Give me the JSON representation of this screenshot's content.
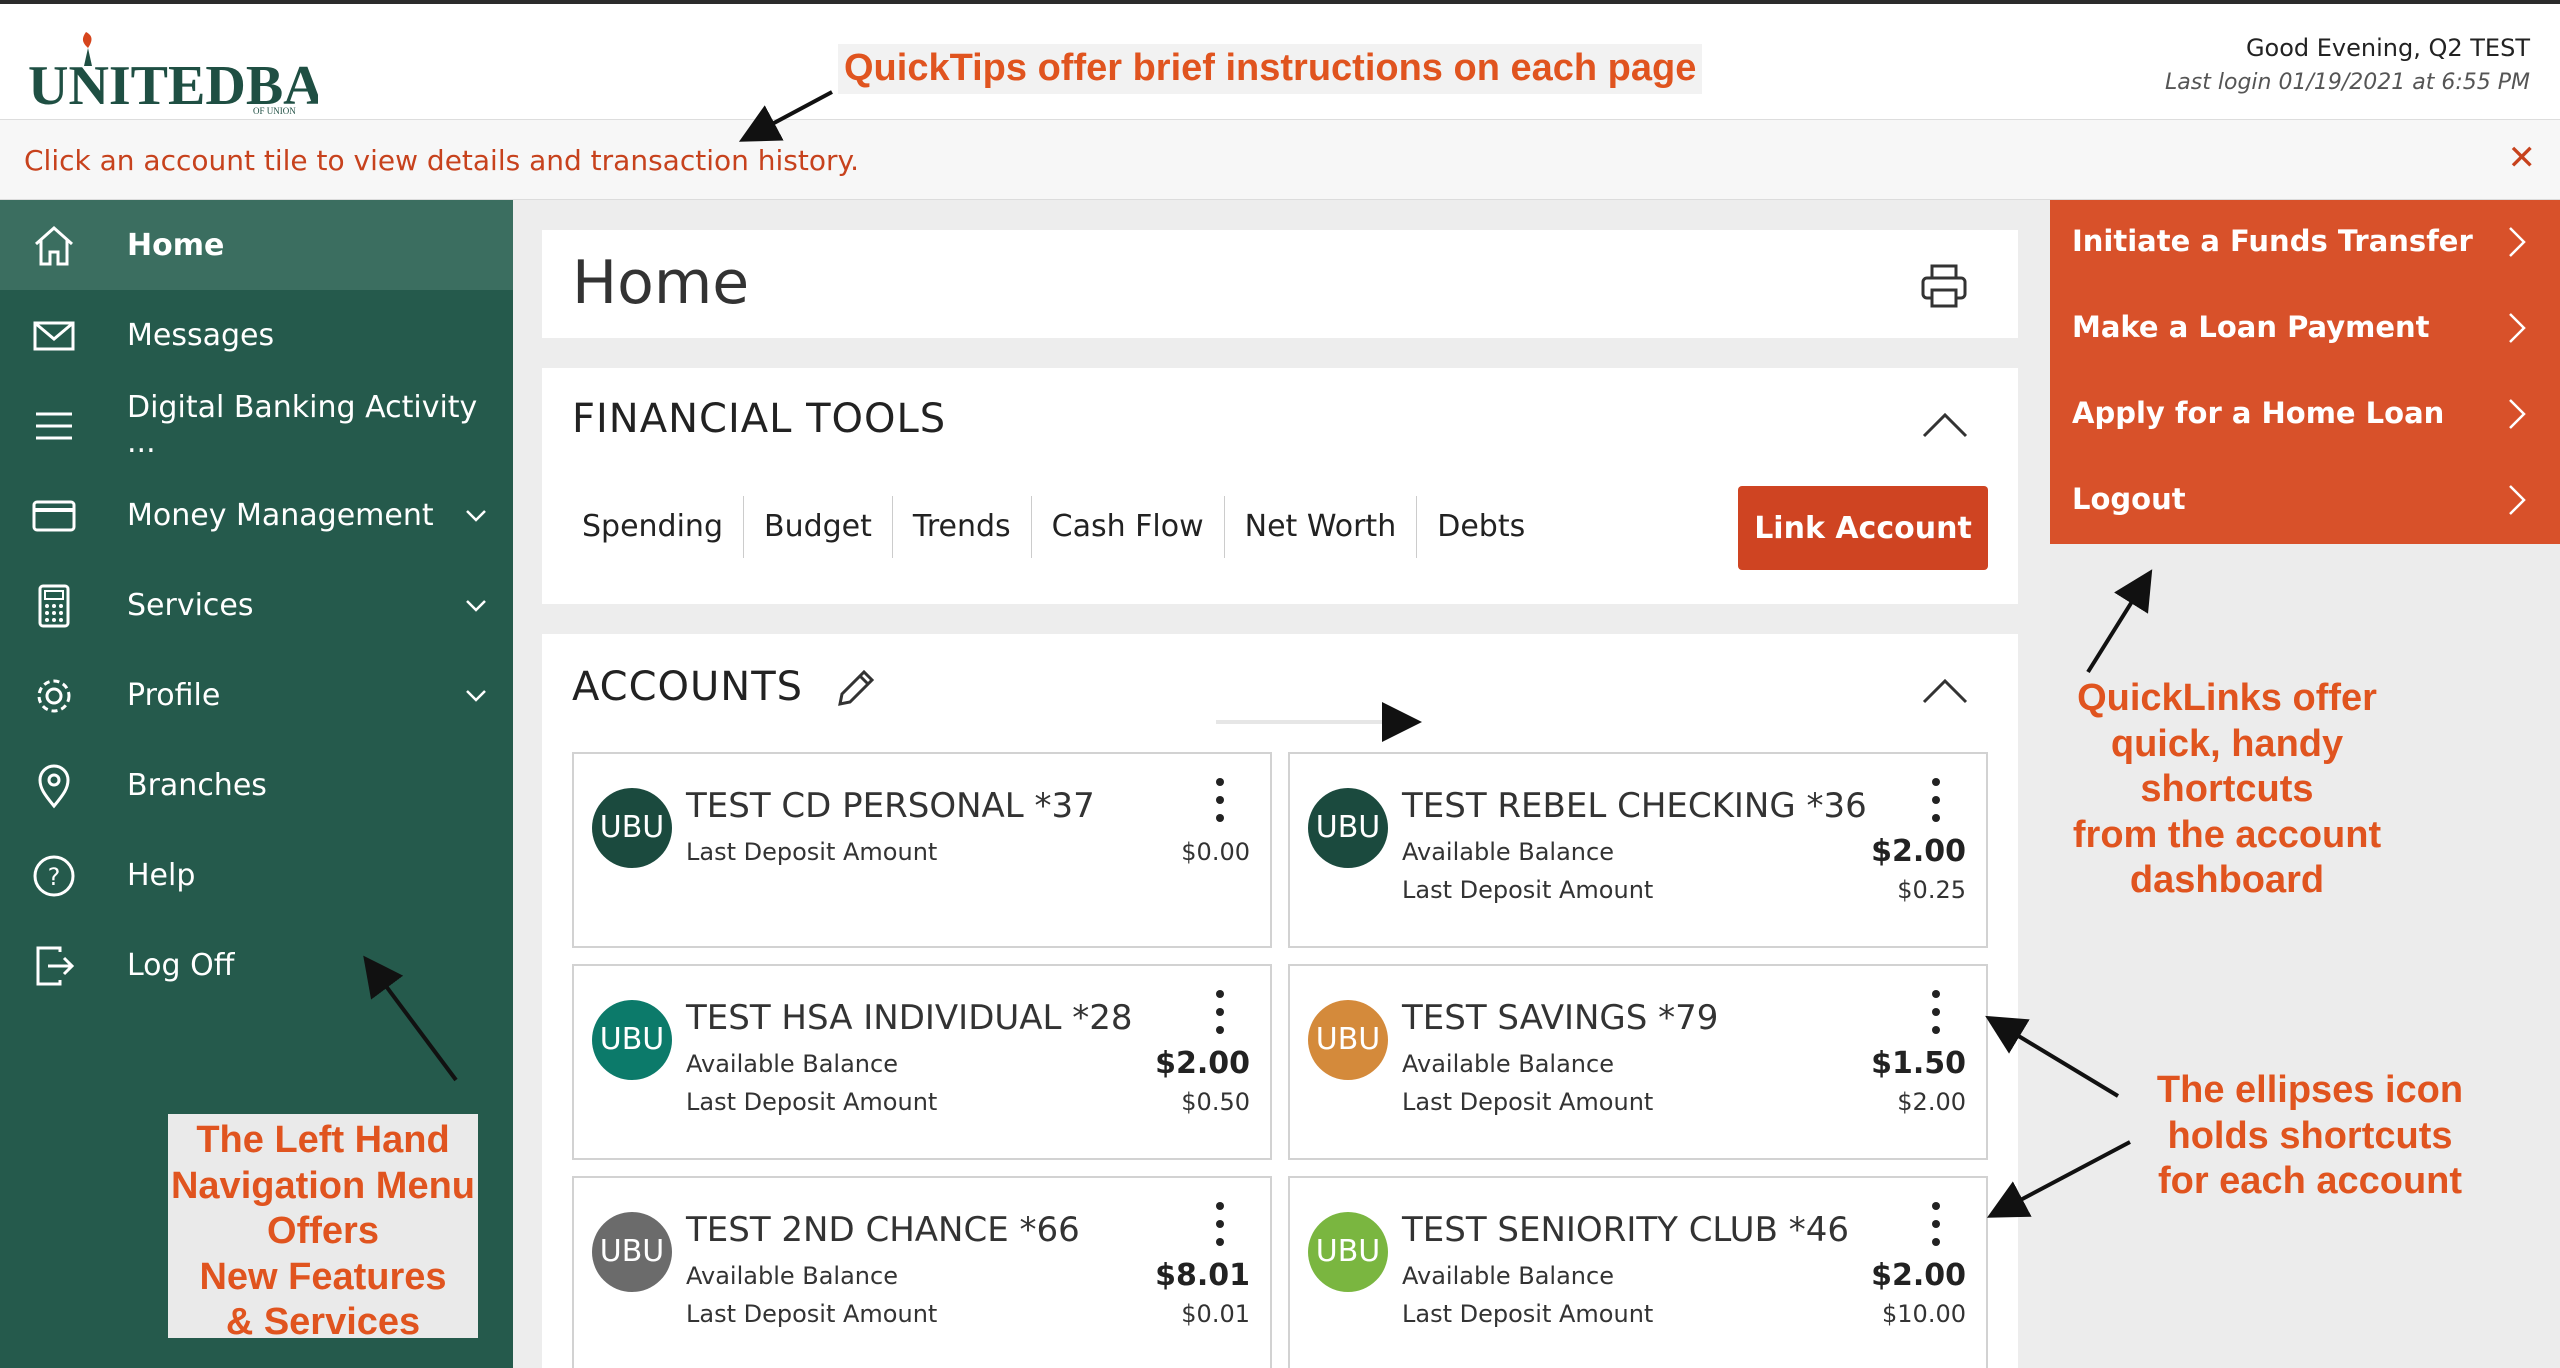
{
  "header": {
    "logo_text": "UNITEDBANK",
    "logo_subtext": "OF UNION",
    "greeting": "Good Evening, Q2 TEST",
    "last_login": "Last login 01/19/2021 at 6:55 PM"
  },
  "quicktip": {
    "message": "Click an account tile to view details and transaction history.",
    "close_icon": "close-icon"
  },
  "sidebar": {
    "items": [
      {
        "label": "Home",
        "icon": "home-icon",
        "active": true
      },
      {
        "label": "Messages",
        "icon": "envelope-icon"
      },
      {
        "label": "Digital Banking Activity ...",
        "icon": "menu-icon"
      },
      {
        "label": "Money Management",
        "icon": "credit-card-icon",
        "expandable": true
      },
      {
        "label": "Services",
        "icon": "calculator-icon",
        "expandable": true
      },
      {
        "label": "Profile",
        "icon": "gear-icon",
        "expandable": true
      },
      {
        "label": "Branches",
        "icon": "map-pin-icon"
      },
      {
        "label": "Help",
        "icon": "help-icon"
      },
      {
        "label": "Log Off",
        "icon": "log-off-icon"
      }
    ]
  },
  "home": {
    "title": "Home",
    "print_icon": "printer-icon"
  },
  "financial_tools": {
    "title": "FINANCIAL TOOLS",
    "tabs": [
      "Spending",
      "Budget",
      "Trends",
      "Cash Flow",
      "Net Worth",
      "Debts"
    ],
    "link_account_label": "Link Account"
  },
  "accounts": {
    "title": "ACCOUNTS",
    "tiles": [
      {
        "badge": "UBU",
        "badge_color": "#1b4a3e",
        "name": "TEST CD PERSONAL *37",
        "label1": "Last Deposit Amount",
        "value1": "$0.00",
        "label2": "",
        "value2": ""
      },
      {
        "badge": "UBU",
        "badge_color": "#1b4a3e",
        "name": "TEST REBEL CHECKING *36",
        "label1": "Available Balance",
        "value1": "$2.00",
        "label2": "Last Deposit Amount",
        "value2": "$0.25"
      },
      {
        "badge": "UBU",
        "badge_color": "#0c7a6a",
        "name": "TEST HSA INDIVIDUAL *28",
        "label1": "Available Balance",
        "value1": "$2.00",
        "label2": "Last Deposit Amount",
        "value2": "$0.50"
      },
      {
        "badge": "UBU",
        "badge_color": "#d48a3b",
        "name": "TEST SAVINGS *79",
        "label1": "Available Balance",
        "value1": "$1.50",
        "label2": "Last Deposit Amount",
        "value2": "$2.00"
      },
      {
        "badge": "UBU",
        "badge_color": "#6b6b6b",
        "name": "TEST 2ND CHANCE *66",
        "label1": "Available Balance",
        "value1": "$8.01",
        "label2": "Last Deposit Amount",
        "value2": "$0.01"
      },
      {
        "badge": "UBU",
        "badge_color": "#7ab640",
        "name": "TEST SENIORITY CLUB *46",
        "label1": "Available Balance",
        "value1": "$2.00",
        "label2": "Last Deposit Amount",
        "value2": "$10.00"
      }
    ]
  },
  "quicklinks": {
    "items": [
      "Initiate a Funds Transfer",
      "Make a Loan Payment",
      "Apply for a Home Loan",
      "Logout"
    ]
  },
  "annotations": {
    "quicktips": "QuickTips offer brief instructions on each page",
    "left_nav": [
      "The Left Hand",
      "Navigation Menu",
      "Offers",
      "New Features",
      "& Services"
    ],
    "quicklinks": [
      "QuickLinks offer",
      "quick, handy",
      "shortcuts",
      "from the account",
      "dashboard"
    ],
    "ellipses": [
      "The ellipses icon",
      "holds shortcuts",
      "for each account"
    ]
  },
  "colors": {
    "sidebar": "#255a4c",
    "sidebar_active": "#3b6e60",
    "accent": "#cf4422",
    "quicklinks": "#d8512a",
    "annotation": "#e0541f"
  }
}
